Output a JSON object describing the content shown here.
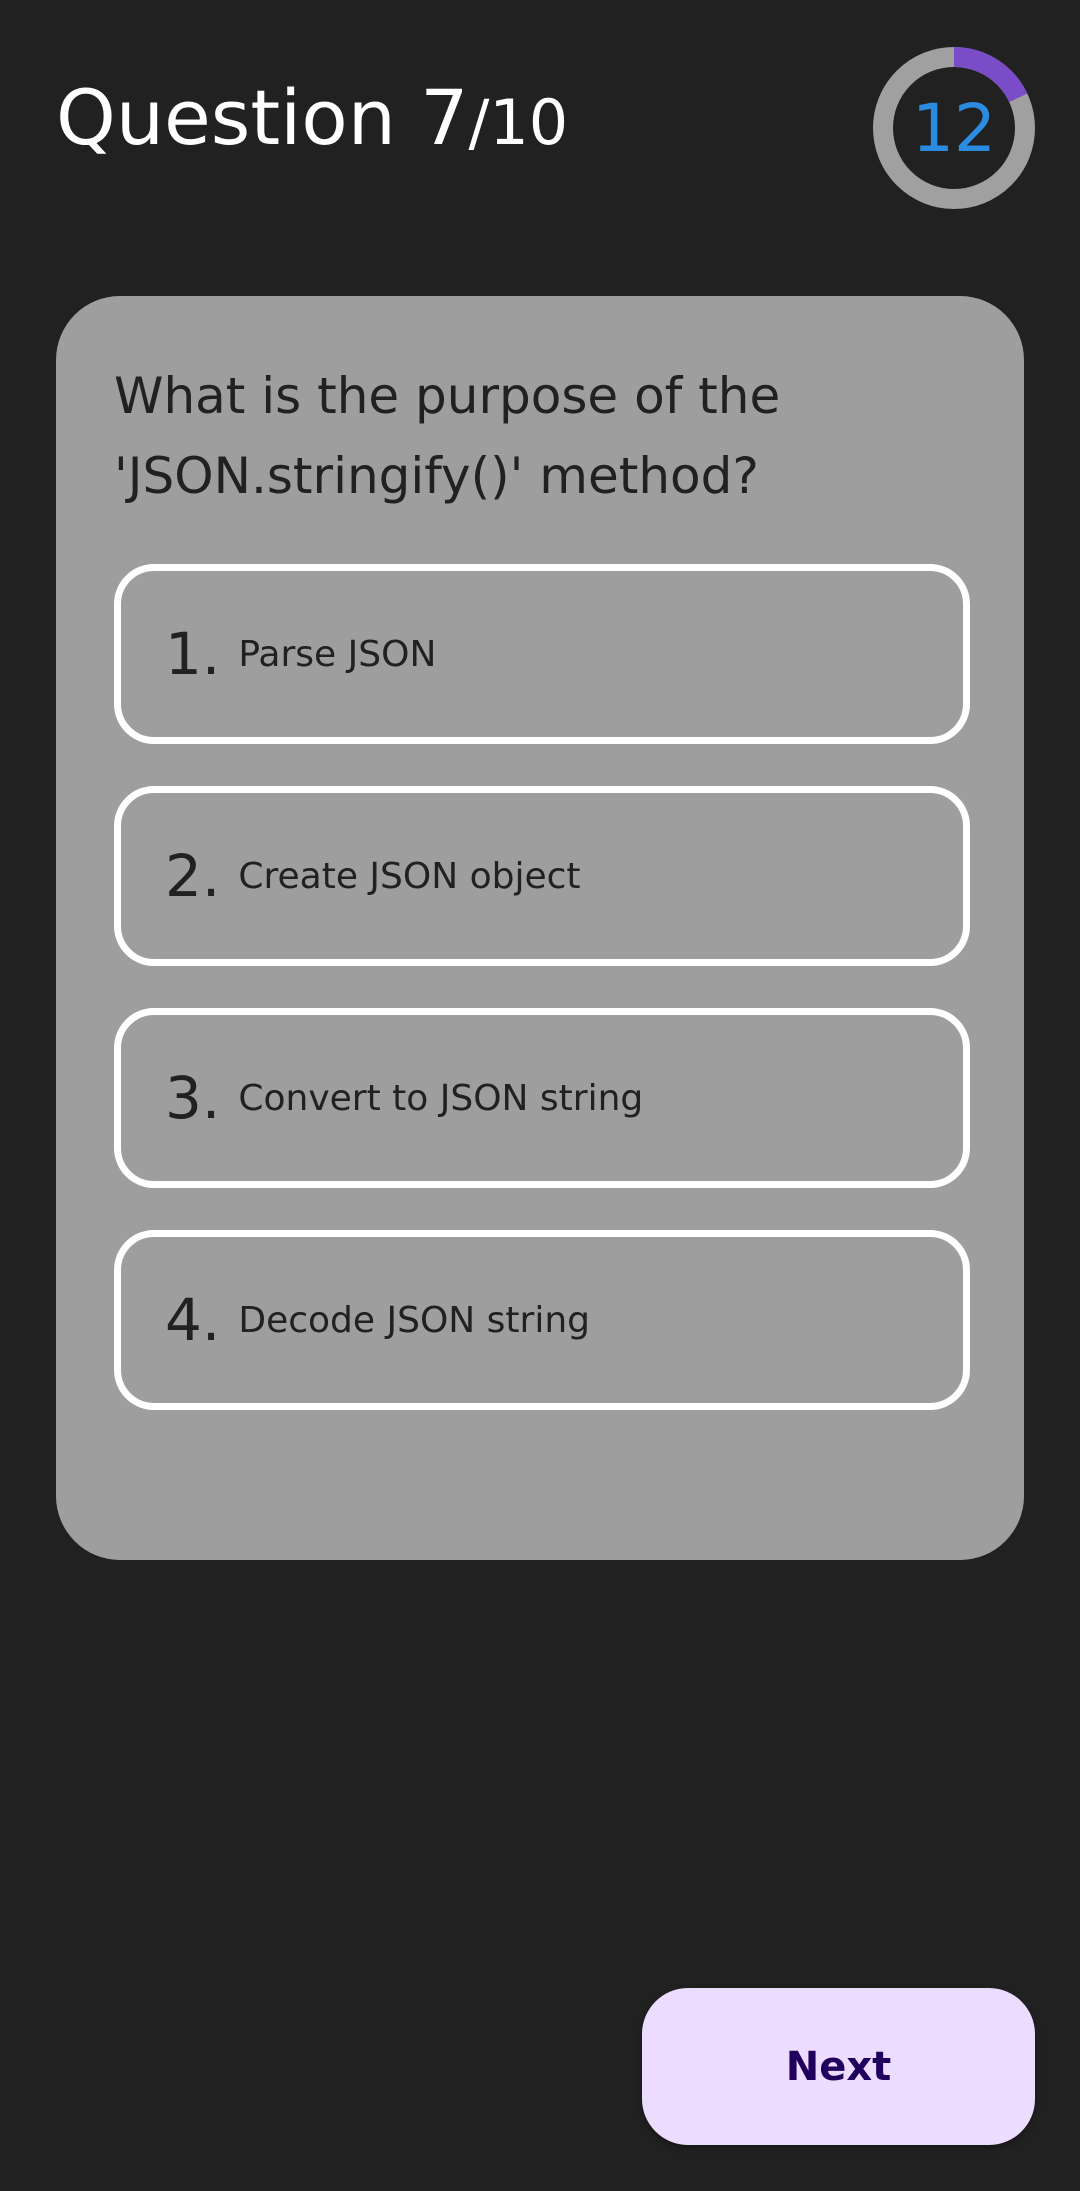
{
  "header": {
    "question_label": "Question ",
    "current": "7",
    "total": "/10"
  },
  "timer": {
    "value": "12",
    "progress_fraction": 0.18,
    "track_color": "#a0a0a0",
    "progress_color": "#7a4cc7",
    "text_color": "#2a8be0"
  },
  "question": {
    "text": "What is the purpose of the 'JSON.stringify()' method?"
  },
  "options": [
    {
      "number": "1",
      "label": "Parse JSON"
    },
    {
      "number": "2",
      "label": "Create JSON object"
    },
    {
      "number": "3",
      "label": "Convert to JSON string"
    },
    {
      "number": "4",
      "label": "Decode JSON string"
    }
  ],
  "next_button": {
    "label": "Next"
  },
  "colors": {
    "background": "#212121",
    "card": "#9e9e9e",
    "option_border": "#ffffff",
    "button_bg": "#ecdcff",
    "button_text": "#21005d"
  }
}
